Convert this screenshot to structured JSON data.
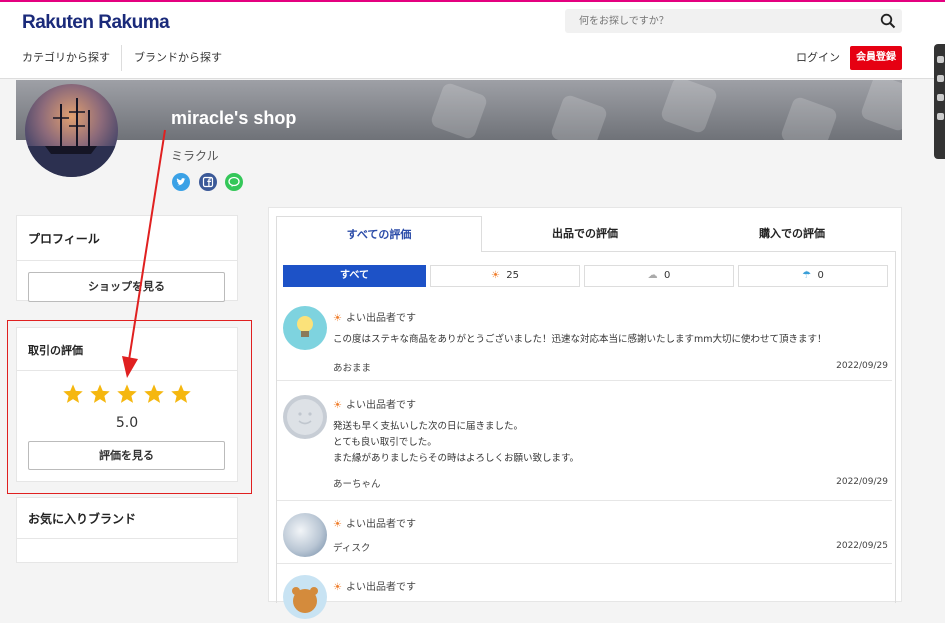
{
  "header": {
    "logo": "Rakuten Rakuma",
    "search_placeholder": "何をお探しですか？",
    "nav_category": "カテゴリから探す",
    "nav_brand": "ブランドから探す",
    "login": "ログイン",
    "register": "会員登録"
  },
  "shop": {
    "name": "miracle's shop",
    "kana": "ミラクル"
  },
  "sidebar": {
    "profile_title": "プロフィール",
    "shop_button": "ショップを見る",
    "rating_title": "取引の評価",
    "rating_stars": 5,
    "rating_score": "5.0",
    "rating_button": "評価を見る",
    "brands_title": "お気に入りブランド"
  },
  "tabs": [
    "すべての評価",
    "出品での評価",
    "購入での評価"
  ],
  "filters": [
    {
      "label": "すべて",
      "count": ""
    },
    {
      "label": "good",
      "count": "25"
    },
    {
      "label": "normal",
      "count": "0"
    },
    {
      "label": "bad",
      "count": "0"
    }
  ],
  "reviews": [
    {
      "label": "よい出品者です",
      "text": "この度はステキな商品をありがとうございました！迅速な対応本当に感謝いたしますmm大切に使わせて頂きます！",
      "user": "あおまま",
      "date": "2022/09/29"
    },
    {
      "label": "よい出品者です",
      "text": "発送も早く支払いした次の日に届きました。\nとても良い取引でした。\nまた縁がありましたらその時はよろしくお願い致します。",
      "user": "あーちゃん",
      "date": "2022/09/29"
    },
    {
      "label": "よい出品者です",
      "text": "",
      "user": "ディスク",
      "date": "2022/09/25"
    },
    {
      "label": "よい出品者です",
      "text": "",
      "user": "",
      "date": ""
    }
  ],
  "colors": {
    "brand_pink": "#e4007f",
    "register_red": "#e60012",
    "active_blue": "#1d52c7",
    "star_gold": "#f5b70f",
    "annotation_red": "#e02020"
  }
}
